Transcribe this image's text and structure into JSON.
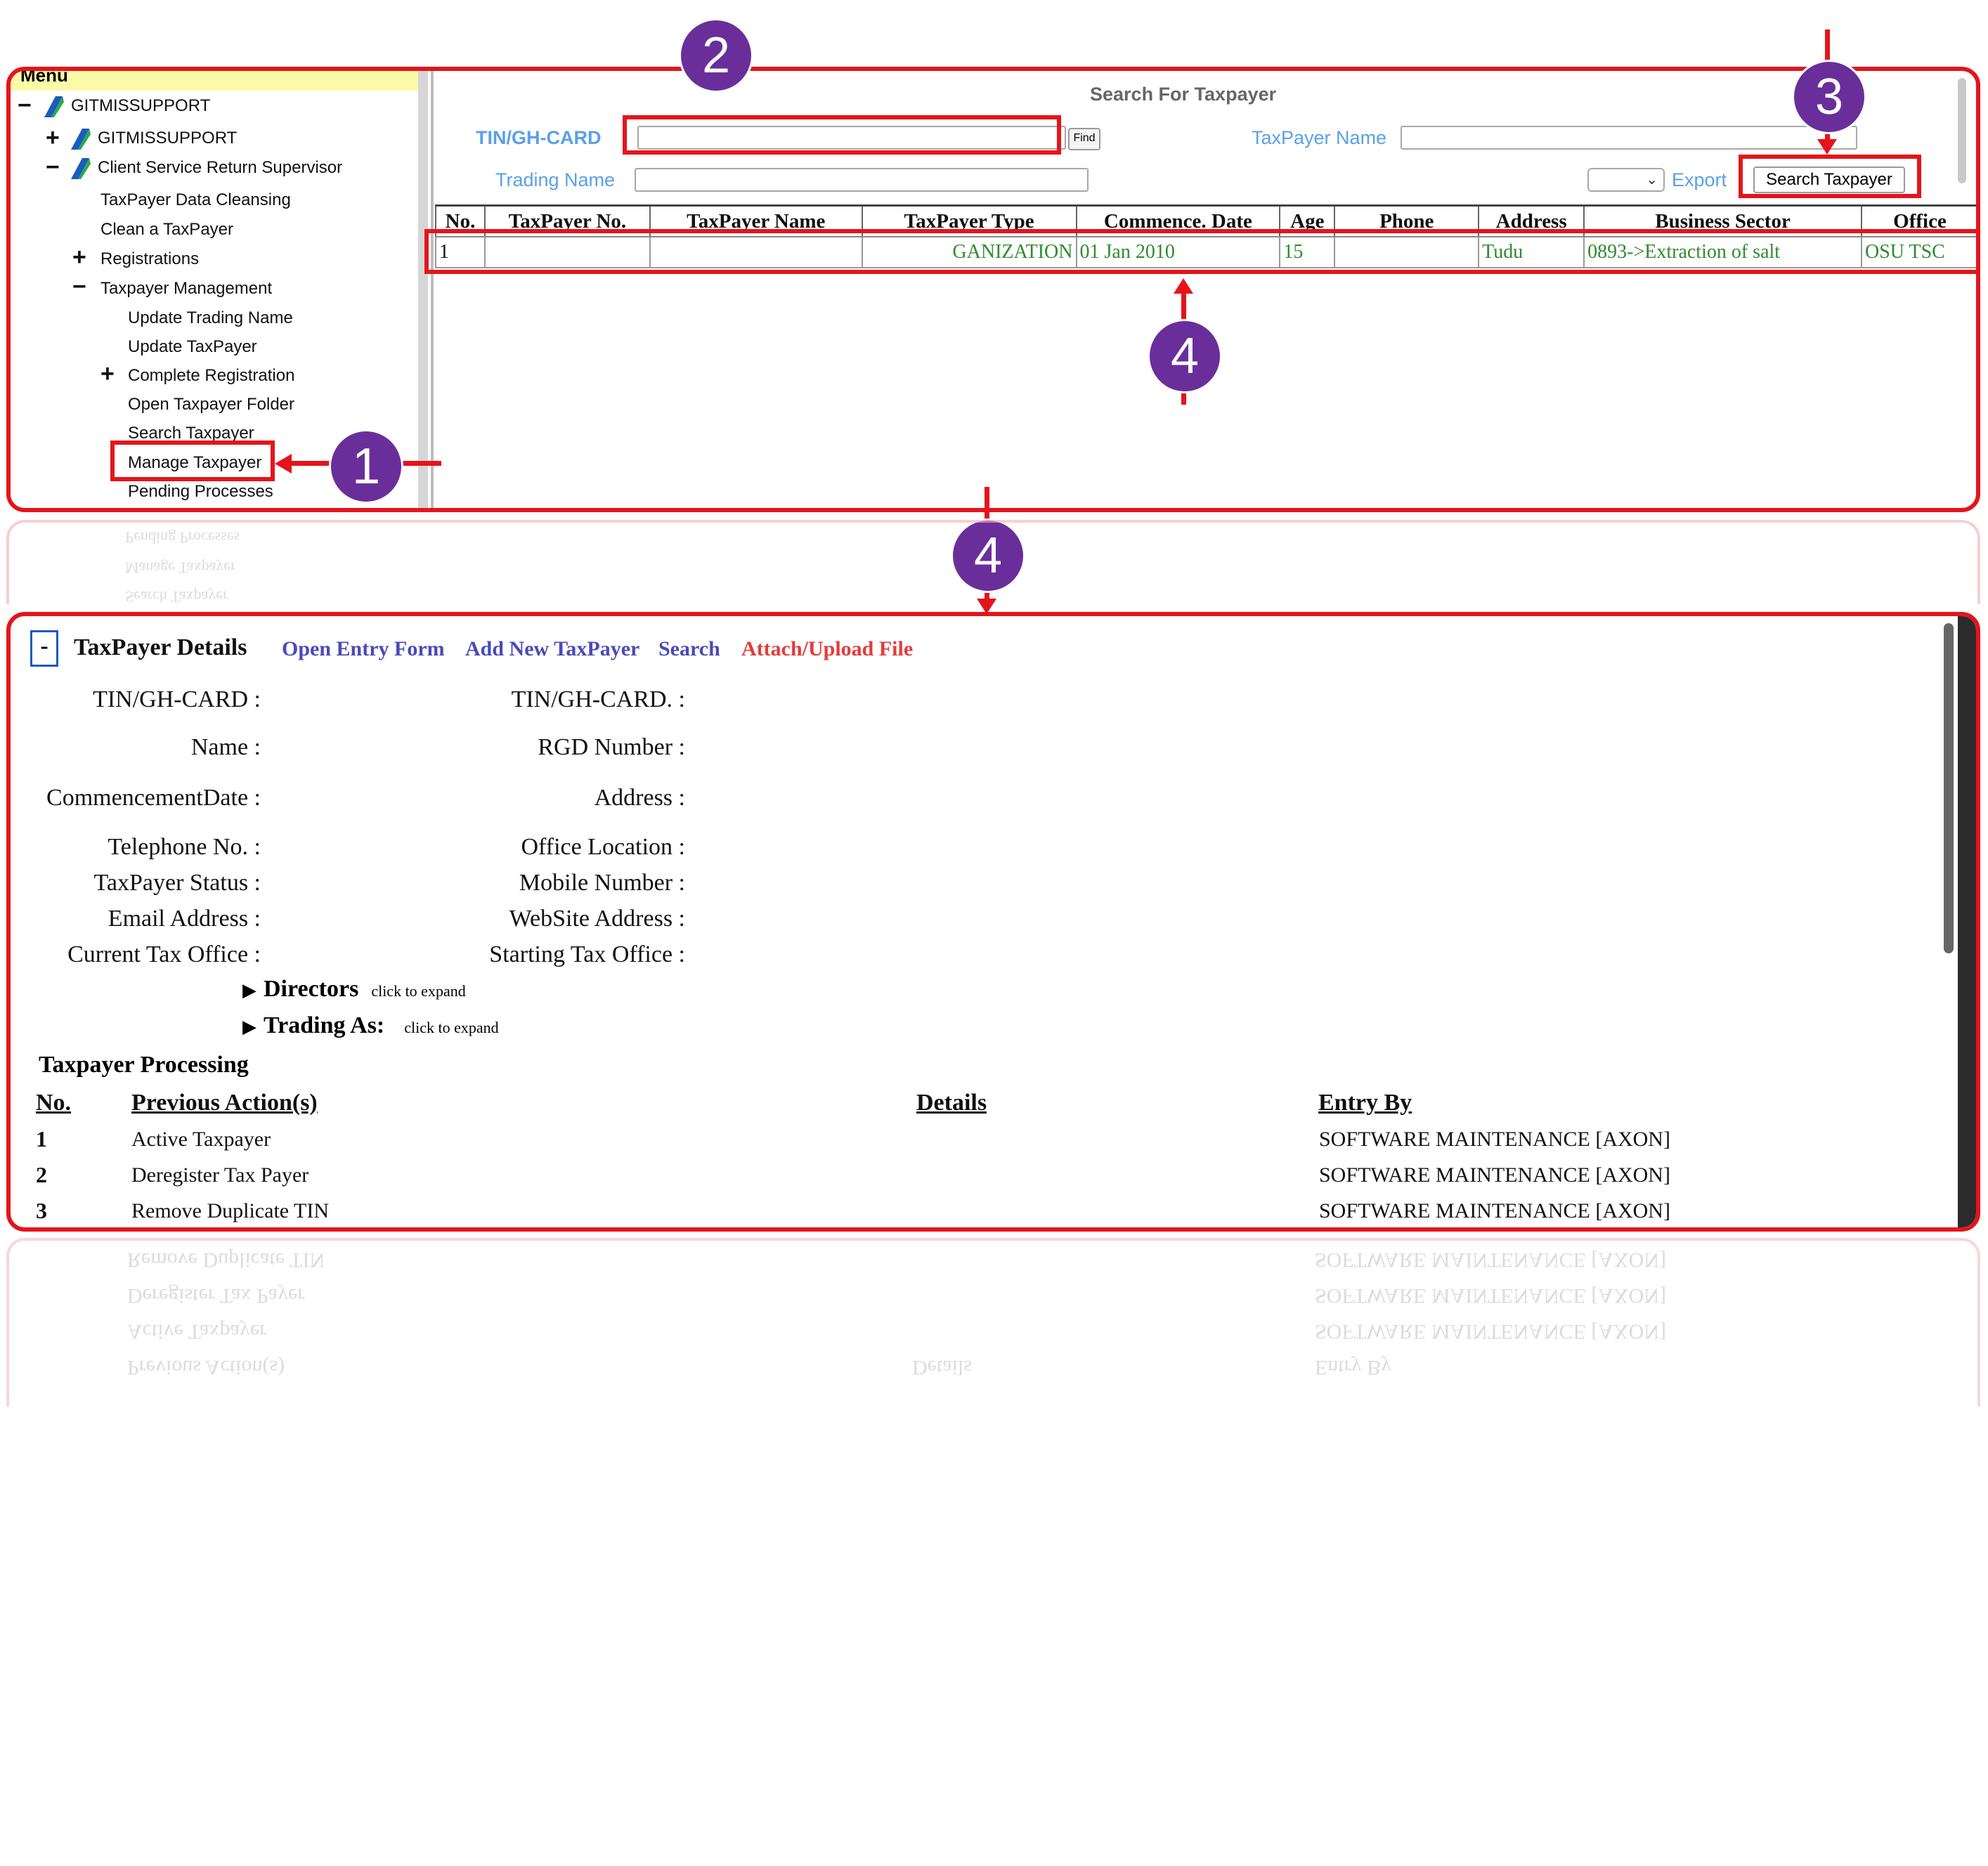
{
  "menu": {
    "header": "Menu",
    "items": [
      {
        "label": "GITMISSUPPORT",
        "toggle": "−"
      },
      {
        "label": "GITMISSUPPORT",
        "toggle": "+"
      },
      {
        "label": "Client Service Return Supervisor",
        "toggle": "−"
      },
      {
        "label": "TaxPayer Data Cleansing"
      },
      {
        "label": "Clean a TaxPayer"
      },
      {
        "label": "Registrations",
        "toggle": "+"
      },
      {
        "label": "Taxpayer Management",
        "toggle": "−"
      },
      {
        "label": "Update Trading Name"
      },
      {
        "label": "Update TaxPayer"
      },
      {
        "label": "Complete Registration",
        "toggle": "+"
      },
      {
        "label": "Open Taxpayer Folder"
      },
      {
        "label": "Search Taxpayer"
      },
      {
        "label": "Manage Taxpayer"
      },
      {
        "label": "Pending Processes"
      }
    ]
  },
  "search": {
    "title": "Search For Taxpayer",
    "tin_label": "TIN/GH-CARD",
    "tin_value": "",
    "find_label": "Find",
    "taxpayer_name_label": "TaxPayer Name",
    "taxpayer_name_value": "",
    "trading_name_label": "Trading Name",
    "trading_name_value": "",
    "export_label": "Export",
    "search_button_label": "Search Taxpayer"
  },
  "results": {
    "columns": [
      "No.",
      "TaxPayer No.",
      "TaxPayer Name",
      "TaxPayer Type",
      "Commence. Date",
      "Age",
      "Phone",
      "Address",
      "Business Sector",
      "Office"
    ],
    "rows": [
      {
        "no": "1",
        "taxpayer_no": "",
        "taxpayer_name": "",
        "taxpayer_type": "GANIZATION",
        "commence_date": "01 Jan 2010",
        "age": "15",
        "phone": "",
        "address": "Tudu",
        "business_sector": "0893->Extraction of salt",
        "office": "OSU TSC"
      }
    ]
  },
  "callouts": {
    "one": "1",
    "two": "2",
    "three": "3",
    "four_a": "4",
    "four_b": "4"
  },
  "details": {
    "toggle": "-",
    "title": "TaxPayer Details",
    "links": {
      "open_entry": "Open Entry Form",
      "add_new": "Add New TaxPayer",
      "search": "Search",
      "attach": "Attach/Upload File"
    },
    "left_labels": [
      "TIN/GH-CARD :",
      "Name :",
      "CommencementDate :",
      "Telephone No. :",
      "TaxPayer Status :",
      "Email Address :",
      "Current Tax Office :"
    ],
    "right_labels": [
      "TIN/GH-CARD. :",
      "RGD Number :",
      "Address :",
      "Office Location :",
      "Mobile Number :",
      "WebSite Address :",
      "Starting Tax Office :"
    ],
    "directors_label": "Directors",
    "directors_hint": "click to expand",
    "trading_label": "Trading As:",
    "trading_hint": "click to expand"
  },
  "processing": {
    "title": "Taxpayer Processing",
    "headers": {
      "no": "No.",
      "action": "Previous Action(s)",
      "details": "Details",
      "entry_by": "Entry By"
    },
    "rows": [
      {
        "no": "1",
        "action": "Active Taxpayer",
        "details": "",
        "entry_by": "SOFTWARE MAINTENANCE [AXON]"
      },
      {
        "no": "2",
        "action": "Deregister Tax Payer",
        "details": "",
        "entry_by": "SOFTWARE MAINTENANCE [AXON]"
      },
      {
        "no": "3",
        "action": "Remove Duplicate TIN",
        "details": "",
        "entry_by": "SOFTWARE MAINTENANCE [AXON]"
      }
    ]
  },
  "colors": {
    "annotation_red": "#e5141b",
    "badge_purple": "#6a2e9a",
    "label_blue": "#5aa0e8",
    "link_blue": "#4a4ab8",
    "link_red": "#e33b3b",
    "value_green": "#2e8b2e"
  }
}
